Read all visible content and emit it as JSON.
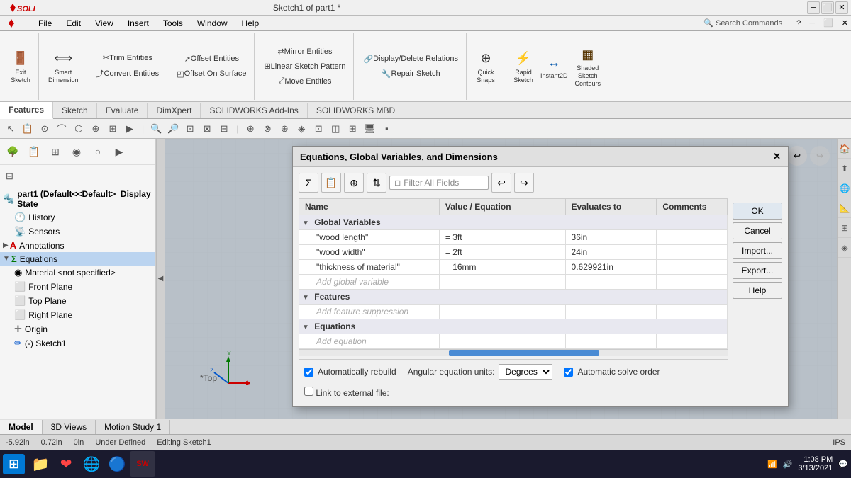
{
  "app": {
    "title": "Sketch1 of part1 *",
    "logo": "SOLIDWORKS",
    "window_title": "Sketch1 of part1 *"
  },
  "menu": {
    "items": [
      "File",
      "Edit",
      "View",
      "Insert",
      "Tools",
      "Window",
      "Help"
    ]
  },
  "toolbar": {
    "groups": [
      {
        "buttons": [
          {
            "label": "Exit Sketch",
            "icon": "✕"
          },
          {
            "label": "Smart Dimension",
            "icon": "◈"
          }
        ]
      }
    ],
    "right_buttons": [
      {
        "label": "Rapid Sketch",
        "icon": "⚡"
      },
      {
        "label": "Instant2D",
        "icon": "↔"
      },
      {
        "label": "Shaded Sketch Contours",
        "icon": "▦"
      }
    ]
  },
  "tabs": {
    "items": [
      "Features",
      "Sketch",
      "Evaluate",
      "DimXpert",
      "SOLIDWORKS Add-Ins",
      "SOLIDWORKS MBD"
    ]
  },
  "sidebar": {
    "tree_title": "part1 (Default<<Default>_Display State",
    "items": [
      {
        "label": "History",
        "icon": "🕒",
        "indent": 1,
        "expandable": false
      },
      {
        "label": "Sensors",
        "icon": "📡",
        "indent": 1,
        "expandable": false
      },
      {
        "label": "Annotations",
        "icon": "A",
        "indent": 1,
        "expandable": true
      },
      {
        "label": "Equations",
        "icon": "Σ",
        "indent": 1,
        "expandable": true,
        "selected": true
      },
      {
        "label": "Material <not specified>",
        "icon": "◉",
        "indent": 1,
        "expandable": false
      },
      {
        "label": "Front Plane",
        "icon": "⬜",
        "indent": 1,
        "expandable": false
      },
      {
        "label": "Top Plane",
        "icon": "⬜",
        "indent": 1,
        "expandable": false
      },
      {
        "label": "Right Plane",
        "icon": "⬜",
        "indent": 1,
        "expandable": false
      },
      {
        "label": "Origin",
        "icon": "✛",
        "indent": 1,
        "expandable": false
      },
      {
        "label": "(-) Sketch1",
        "icon": "✏",
        "indent": 1,
        "expandable": false
      }
    ]
  },
  "dialog": {
    "title": "Equations, Global Variables, and Dimensions",
    "filter_placeholder": "Filter All Fields",
    "columns": [
      "Name",
      "Value / Equation",
      "Evaluates to",
      "Comments"
    ],
    "sections": [
      {
        "name": "Global Variables",
        "rows": [
          {
            "name": "\"wood length\"",
            "value": "= 3ft",
            "evaluates": "36in",
            "comments": ""
          },
          {
            "name": "\"wood width\"",
            "value": "= 2ft",
            "evaluates": "24in",
            "comments": ""
          },
          {
            "name": "\"thickness of material\"",
            "value": "= 16mm",
            "evaluates": "0.629921in",
            "comments": ""
          },
          {
            "name": "Add global variable",
            "value": "",
            "evaluates": "",
            "comments": "",
            "is_add": true
          }
        ]
      },
      {
        "name": "Features",
        "rows": [
          {
            "name": "Add feature suppression",
            "value": "",
            "evaluates": "",
            "comments": "",
            "is_add": true
          }
        ]
      },
      {
        "name": "Equations",
        "rows": [
          {
            "name": "Add equation",
            "value": "",
            "evaluates": "",
            "comments": "",
            "is_add": true
          }
        ]
      }
    ],
    "buttons": [
      "OK",
      "Cancel",
      "Import...",
      "Export...",
      "Help"
    ],
    "options": {
      "auto_rebuild": "Automatically rebuild",
      "angular_label": "Angular equation units:",
      "angular_value": "Degrees",
      "auto_solve": "Automatic solve order",
      "link_external": "Link to external file:"
    }
  },
  "bottom_tabs": [
    "Model",
    "3D Views",
    "Motion Study 1"
  ],
  "status_bar": {
    "coords": "-5.92in",
    "x_val": "0.72in",
    "y_val": "0in",
    "state": "Under Defined",
    "mode": "Editing Sketch1",
    "unit": "IPS"
  },
  "taskbar": {
    "clock_time": "1:08 PM",
    "clock_date": "3/13/2021"
  },
  "view_bottom": "*Top",
  "icons": {
    "search": "🔍",
    "undo": "↩",
    "redo": "↪",
    "filter": "⊟",
    "expand": "▸",
    "collapse": "▾",
    "minus": "−",
    "plus": "+"
  }
}
